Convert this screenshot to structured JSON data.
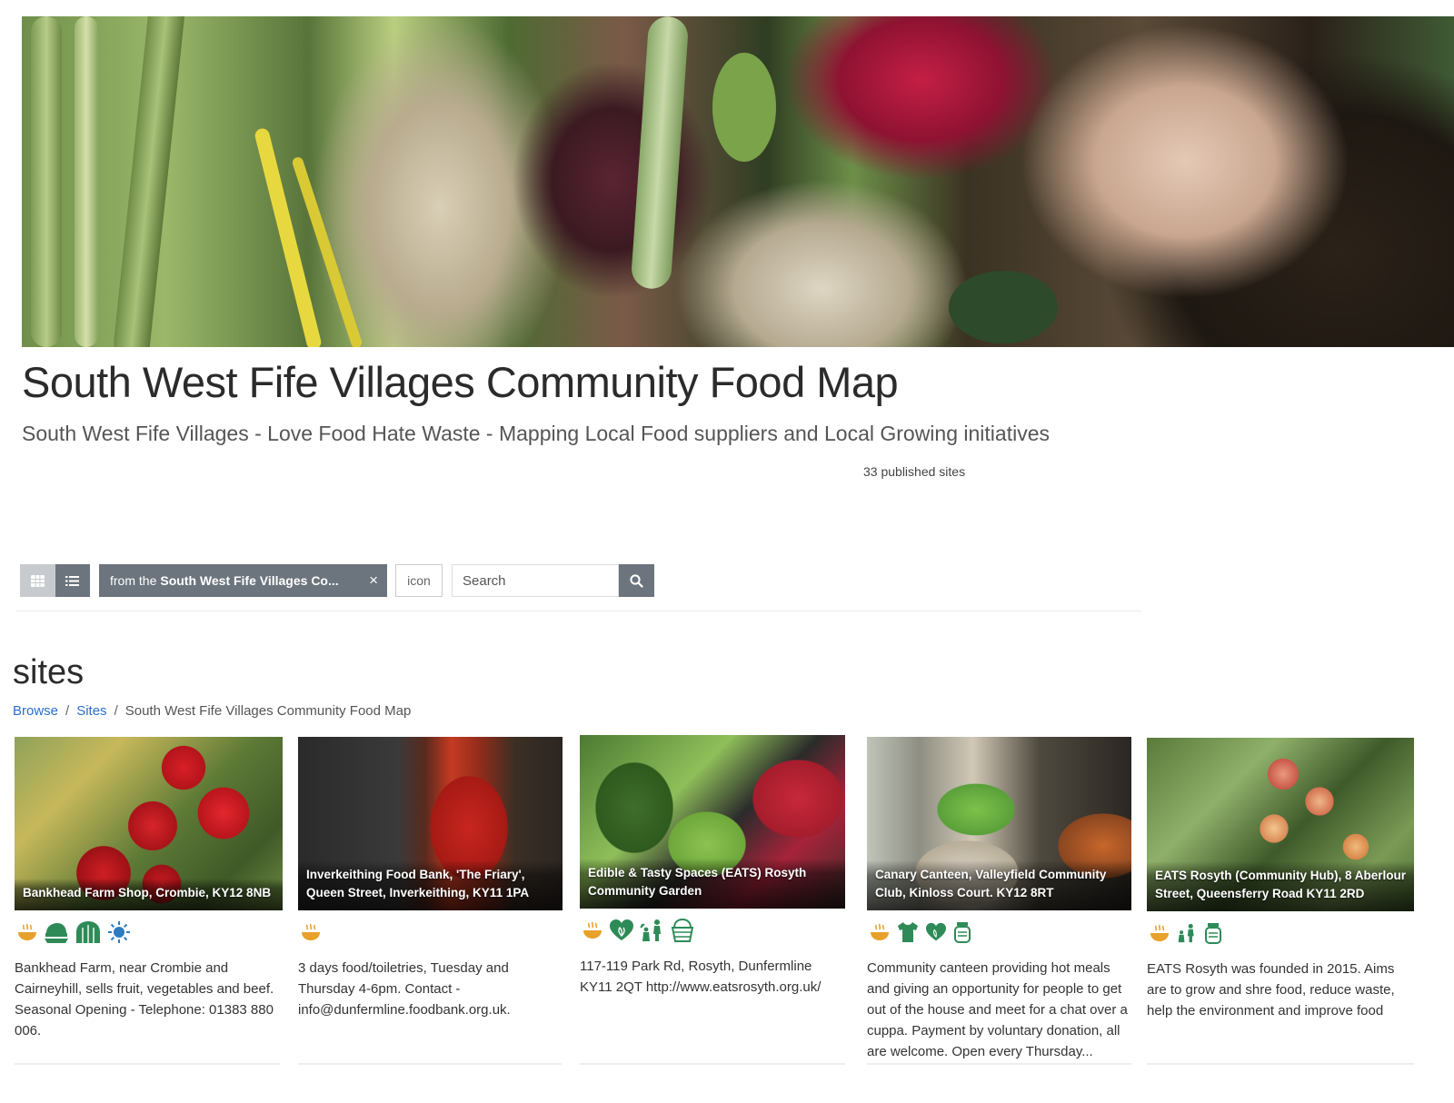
{
  "header": {
    "title": "South West Fife Villages Community Food Map",
    "subtitle": "South West Fife Villages - Love Food Hate Waste - Mapping Local Food suppliers and Local Growing initiatives",
    "published_count": "33 published sites"
  },
  "toolbar": {
    "filter_prefix": "from the",
    "filter_value": "South West Fife Villages Co...",
    "filter_close": "×",
    "icon_placeholder": "icon",
    "search_placeholder": "Search"
  },
  "section": {
    "heading": "sites"
  },
  "breadcrumb": {
    "items": [
      "Browse",
      "Sites",
      "South West Fife Villages Community Food Map"
    ],
    "separator": "/"
  },
  "cards": [
    {
      "caption": "Bankhead Farm Shop, Crombie, KY12 8NB",
      "icons": [
        "soup-bowl-icon",
        "farm-produce-icon",
        "polytunnel-icon",
        "sun-icon"
      ],
      "description": "Bankhead Farm, near Crombie and Cairneyhill, sells fruit, vegetables and beef. Seasonal Opening -  Telephone: 01383 880 006."
    },
    {
      "caption": "Inverkeithing Food Bank, 'The Friary', Queen Street, Inverkeithing, KY11 1PA",
      "icons": [
        "soup-bowl-icon"
      ],
      "description": "3 days food/toiletries, Tuesday and Thursday 4-6pm. Contact - info@dunfermline.foodbank.org.uk."
    },
    {
      "caption": "Edible & Tasty Spaces (EATS) Rosyth Community Garden",
      "icons": [
        "soup-bowl-icon",
        "heart-leaf-icon",
        "gardeners-icon",
        "basket-icon"
      ],
      "description": "117-119 Park Rd, Rosyth, Dunfermline KY11 2QT http://www.eatsrosyth.org.uk/"
    },
    {
      "caption": "Canary Canteen, Valleyfield Community Club, Kinloss Court. KY12 8RT",
      "icons": [
        "soup-bowl-icon",
        "shirt-icon",
        "heart-leaf-icon",
        "jar-icon"
      ],
      "description": "Community canteen providing hot meals and giving an opportunity for people to get out of the house and meet for a chat over a cuppa. Payment by voluntary donation, all are welcome. Open every Thursday..."
    },
    {
      "caption": "EATS Rosyth (Community Hub), 8 Aberlour Street, Queensferry Road KY11 2RD",
      "icons": [
        "soup-bowl-icon",
        "gardeners-icon",
        "jar-icon"
      ],
      "description": "EATS Rosyth was founded in 2015. Aims are to grow and shre food, reduce waste, help the environment and improve food"
    }
  ],
  "colors": {
    "icon_orange": "#e8a12a",
    "icon_green": "#2e8b57",
    "icon_blue": "#2b7cc1",
    "link_blue": "#2a6fcf",
    "toolbar_gray": "#6c757d"
  }
}
